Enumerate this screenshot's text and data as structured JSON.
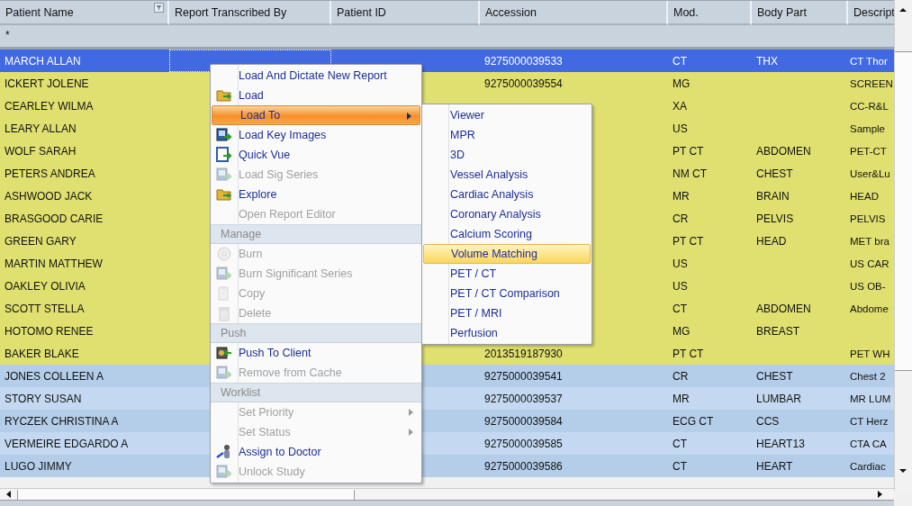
{
  "table": {
    "columns": [
      "Patient Name",
      "Report Transcribed By",
      "Patient ID",
      "Accession",
      "Mod.",
      "Body Part",
      "Descript"
    ],
    "filter_row": "*",
    "rows": [
      {
        "name": "MARCH ALLAN",
        "accession": "9275000039533",
        "mod": "CT",
        "body_part": "THX",
        "description": "CT Thor",
        "selected": true
      },
      {
        "name": "ICKERT JOLENE",
        "accession": "9275000039554",
        "mod": "MG",
        "description": "SCREEN",
        "color": "#e0e070",
        "selected": false
      },
      {
        "name": "CEARLEY WILMA",
        "mod": "XA",
        "description": "CC-R&L",
        "color": "#e0e070",
        "selected": false
      },
      {
        "name": "LEARY ALLAN",
        "mod": "US",
        "description": "Sample",
        "color": "#e0e070",
        "selected": false
      },
      {
        "name": "WOLF SARAH",
        "mod": "PT CT",
        "body_part": "ABDOMEN",
        "description": "PET-CT",
        "color": "#e0e070",
        "selected": false
      },
      {
        "name": "PETERS ANDREA",
        "mod": "NM CT",
        "body_part": "CHEST",
        "description": "User&Lu",
        "color": "#e0e070",
        "selected": false
      },
      {
        "name": "ASHWOOD JACK",
        "mod": "MR",
        "body_part": "BRAIN",
        "description": "HEAD",
        "color": "#e0e070",
        "selected": false
      },
      {
        "name": "BRASGOOD CARIE",
        "mod": "CR",
        "body_part": "PELVIS",
        "description": "PELVIS",
        "color": "#e0e070",
        "selected": false
      },
      {
        "name": "GREEN GARY",
        "mod": "PT CT",
        "body_part": "HEAD",
        "description": "MET bra",
        "color": "#e0e070",
        "selected": false
      },
      {
        "name": "MARTIN MATTHEW",
        "mod": "US",
        "description": "US CAR",
        "color": "#e0e070",
        "selected": false
      },
      {
        "name": "OAKLEY OLIVIA",
        "mod": "US",
        "description": "US OB-",
        "color": "#e0e070",
        "selected": false
      },
      {
        "name": "SCOTT STELLA",
        "mod": "CT",
        "body_part": "ABDOMEN",
        "description": "Abdome",
        "color": "#e0e070",
        "selected": false
      },
      {
        "name": "HOTOMO RENEE",
        "mod": "MG",
        "body_part": "BREAST",
        "color": "#e0e070",
        "selected": false
      },
      {
        "name": "BAKER BLAKE",
        "accession": "2013519187930",
        "mod": "PT CT",
        "description": "PET WH",
        "color": "#e0e070",
        "selected": false
      },
      {
        "name": "JONES COLLEEN A",
        "accession": "9275000039541",
        "mod": "CR",
        "body_part": "CHEST",
        "description": "Chest 2",
        "color": "#b4cde9",
        "selected": false
      },
      {
        "name": "STORY SUSAN",
        "accession": "9275000039537",
        "mod": "MR",
        "body_part": "LUMBAR",
        "description": "MR LUM",
        "color": "#c4d9f1",
        "selected": false
      },
      {
        "name": "RYCZEK CHRISTINA A",
        "accession": "9275000039584",
        "mod": "ECG CT",
        "body_part": "CCS",
        "description": "CT Herz",
        "color": "#b4cde9",
        "selected": false
      },
      {
        "name": "VERMEIRE EDGARDO A",
        "accession": "9275000039585",
        "mod": "CT",
        "body_part": "HEART13",
        "description": "CTA CA",
        "color": "#c4d9f1",
        "selected": false
      },
      {
        "name": "LUGO JIMMY",
        "accession": "9275000039586",
        "mod": "CT",
        "body_part": "HEART",
        "description": "Cardiac",
        "color": "#b4cde9",
        "selected": false
      }
    ]
  },
  "context_menu": {
    "items": [
      {
        "kind": "item",
        "label": "Load And Dictate New Report",
        "icon": false,
        "disabled": false,
        "selected": false,
        "has_submenu": false
      },
      {
        "kind": "item",
        "label": "Load",
        "icon": true,
        "disabled": false,
        "selected": false,
        "has_submenu": false
      },
      {
        "kind": "item",
        "label": "Load To",
        "icon": false,
        "disabled": false,
        "selected": true,
        "has_submenu": true
      },
      {
        "kind": "item",
        "label": "Load Key Images",
        "icon": true,
        "disabled": false,
        "selected": false,
        "has_submenu": false
      },
      {
        "kind": "item",
        "label": "Quick Vue",
        "icon": true,
        "disabled": false,
        "selected": false,
        "has_submenu": false
      },
      {
        "kind": "item",
        "label": "Load Sig Series",
        "icon": true,
        "disabled": true,
        "selected": false,
        "has_submenu": false
      },
      {
        "kind": "item",
        "label": "Explore",
        "icon": true,
        "disabled": false,
        "selected": false,
        "has_submenu": false
      },
      {
        "kind": "item",
        "label": "Open Report Editor",
        "icon": false,
        "disabled": true,
        "selected": false,
        "has_submenu": false
      },
      {
        "kind": "header",
        "label": "Manage"
      },
      {
        "kind": "item",
        "label": "Burn",
        "icon": true,
        "disabled": true,
        "selected": false,
        "has_submenu": false
      },
      {
        "kind": "item",
        "label": "Burn Significant Series",
        "icon": true,
        "disabled": true,
        "selected": false,
        "has_submenu": false
      },
      {
        "kind": "item",
        "label": "Copy",
        "icon": true,
        "disabled": true,
        "selected": false,
        "has_submenu": false
      },
      {
        "kind": "item",
        "label": "Delete",
        "icon": true,
        "disabled": true,
        "selected": false,
        "has_submenu": false
      },
      {
        "kind": "header",
        "label": "Push"
      },
      {
        "kind": "item",
        "label": "Push To Client",
        "icon": true,
        "disabled": false,
        "selected": false,
        "has_submenu": false
      },
      {
        "kind": "item",
        "label": "Remove from Cache",
        "icon": true,
        "disabled": true,
        "selected": false,
        "has_submenu": false
      },
      {
        "kind": "header",
        "label": "Worklist"
      },
      {
        "kind": "item",
        "label": "Set Priority",
        "icon": false,
        "disabled": true,
        "selected": false,
        "has_submenu": true
      },
      {
        "kind": "item",
        "label": "Set Status",
        "icon": false,
        "disabled": true,
        "selected": false,
        "has_submenu": true
      },
      {
        "kind": "item",
        "label": "Assign to Doctor",
        "icon": true,
        "disabled": false,
        "selected": false,
        "has_submenu": false
      },
      {
        "kind": "item",
        "label": "Unlock Study",
        "icon": true,
        "disabled": true,
        "selected": false,
        "has_submenu": false
      }
    ]
  },
  "submenu": {
    "items": [
      {
        "label": "Viewer",
        "selected": false
      },
      {
        "label": "MPR",
        "selected": false
      },
      {
        "label": "3D",
        "selected": false
      },
      {
        "label": "Vessel Analysis",
        "selected": false
      },
      {
        "label": "Cardiac Analysis",
        "selected": false
      },
      {
        "label": "Coronary Analysis",
        "selected": false
      },
      {
        "label": "Calcium Scoring",
        "selected": false
      },
      {
        "label": "Volume Matching",
        "selected": true
      },
      {
        "label": "PET / CT",
        "selected": false
      },
      {
        "label": "PET / CT Comparison",
        "selected": false
      },
      {
        "label": "PET / MRI",
        "selected": false
      },
      {
        "label": "Perfusion",
        "selected": false
      }
    ]
  }
}
